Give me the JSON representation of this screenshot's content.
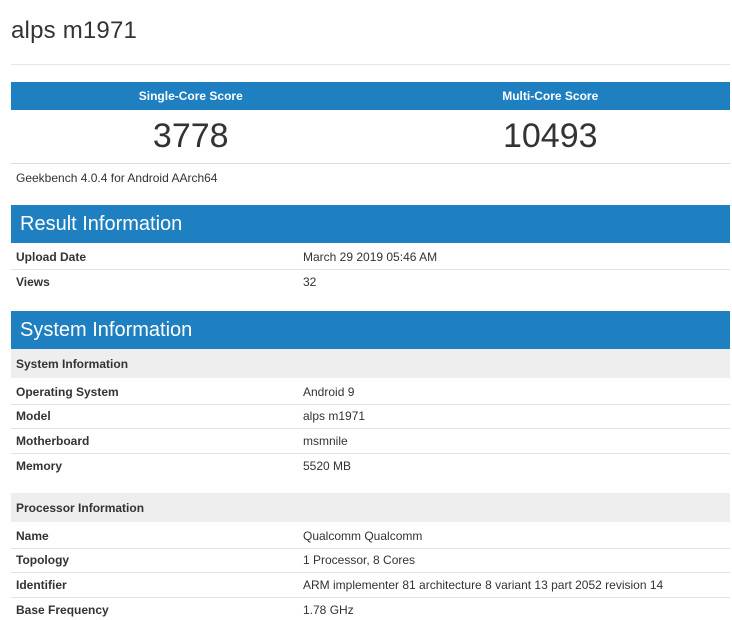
{
  "device_title": "alps m1971",
  "scores": {
    "single_label": "Single-Core Score",
    "multi_label": "Multi-Core Score",
    "single_value": "3778",
    "multi_value": "10493",
    "version": "Geekbench 4.0.4 for Android AArch64"
  },
  "result_info": {
    "title": "Result Information",
    "rows": [
      {
        "label": "Upload Date",
        "value": "March 29 2019 05:46 AM"
      },
      {
        "label": "Views",
        "value": "32"
      }
    ]
  },
  "system_info": {
    "title": "System Information",
    "system_sub": "System Information",
    "system_rows": [
      {
        "label": "Operating System",
        "value": "Android 9"
      },
      {
        "label": "Model",
        "value": "alps m1971"
      },
      {
        "label": "Motherboard",
        "value": "msmnile"
      },
      {
        "label": "Memory",
        "value": "5520 MB"
      }
    ],
    "processor_sub": "Processor Information",
    "processor_rows": [
      {
        "label": "Name",
        "value": "Qualcomm Qualcomm"
      },
      {
        "label": "Topology",
        "value": "1 Processor, 8 Cores"
      },
      {
        "label": "Identifier",
        "value": "ARM implementer 81 architecture 8 variant 13 part 2052 revision 14"
      },
      {
        "label": "Base Frequency",
        "value": "1.78 GHz"
      }
    ]
  },
  "colors": {
    "header_blue": "#1e7fc1",
    "subheader_gray": "#eeeeee"
  }
}
